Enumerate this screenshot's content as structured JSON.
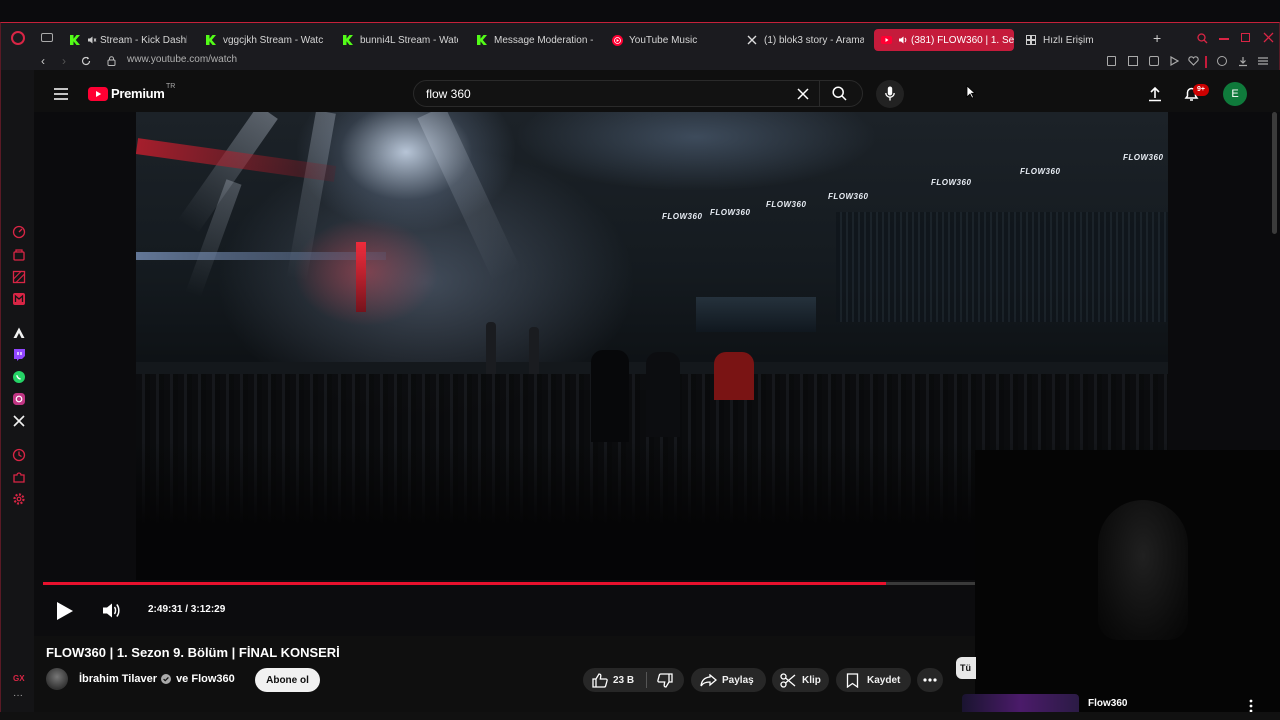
{
  "browser": {
    "tabs": [
      {
        "label": "Stream - Kick Dashb",
        "icon": "kick-icon",
        "muted": true
      },
      {
        "label": "vggcjkh Stream - Watc",
        "icon": "kick-icon"
      },
      {
        "label": "bunni4L Stream - Watc",
        "icon": "kick-icon"
      },
      {
        "label": "Message Moderation -",
        "icon": "kick-icon"
      },
      {
        "label": "YouTube Music",
        "icon": "youtube-music-icon"
      },
      {
        "label": "(1) blok3 story - Arama",
        "icon": "x-icon"
      },
      {
        "label": "(381) FLOW360 | 1. Se",
        "icon": "youtube-icon",
        "active": true
      },
      {
        "label": "Hızlı Erişim",
        "icon": "grid-icon"
      }
    ],
    "url": "www.youtube.com/watch"
  },
  "youtube": {
    "logo_text": "Premium",
    "logo_region": "TR",
    "search_value": "flow 360",
    "notifications_badge": "9+",
    "avatar_letter": "E"
  },
  "video": {
    "overlay_texts": [
      "FLOW360",
      "FLOW360",
      "FLOW360",
      "FLOW360",
      "FLOW360",
      "FLOW360",
      "FLOW360"
    ],
    "timecode": "2:49:31 / 3:12:29",
    "progress": 0.905,
    "title": "FLOW360 | 1. Sezon 9. Bölüm | FİNAL KONSERİ",
    "channel": "İbrahim Tilaver",
    "channel_suffix": "ve Flow360",
    "subscribe_label": "Abone ol",
    "likes": "23 B",
    "share_label": "Paylaş",
    "clip_label": "Klip",
    "save_label": "Kaydet"
  },
  "sidebar_right": {
    "chip_label": "Tü",
    "recommended_title": "Flow360"
  },
  "colors": {
    "accent": "#c51b3b",
    "progress": "#e8112d",
    "avatar": "#0f7a3b"
  }
}
